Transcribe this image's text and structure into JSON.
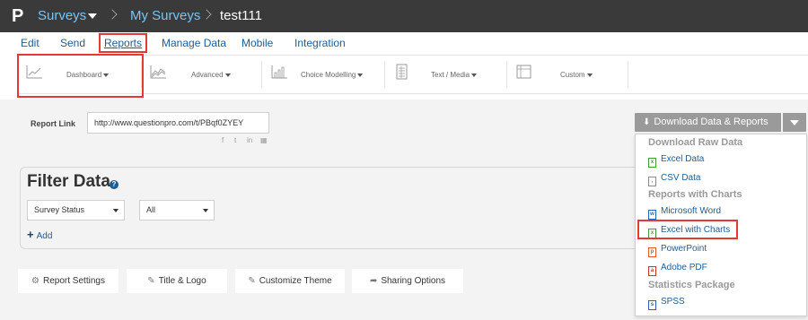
{
  "topbar": {
    "logo": "P",
    "surveys_label": "Surveys",
    "my_surveys_label": "My Surveys",
    "current_survey": "test111"
  },
  "main_nav": [
    "Edit",
    "Send",
    "Reports",
    "Manage Data",
    "Mobile",
    "Integration"
  ],
  "sub_nav": [
    "Dashboard",
    "Advanced",
    "Choice Modelling",
    "Text / Media",
    "Custom"
  ],
  "report_link": {
    "label": "Report Link",
    "value": "http://www.questionpro.com/t/PBqf0ZYEY"
  },
  "download_button": {
    "label": "Download Data & Reports"
  },
  "dropdown": {
    "raw_header": "Download Raw Data",
    "excel_data": "Excel Data",
    "csv_data": "CSV Data",
    "charts_header": "Reports with Charts",
    "word": "Microsoft Word",
    "excel_charts": "Excel with Charts",
    "powerpoint": "PowerPoint",
    "pdf": "Adobe PDF",
    "stats_header": "Statistics Package",
    "spss": "SPSS"
  },
  "filter": {
    "title": "Filter Data",
    "status_select": "Survey Status",
    "all_select": "All",
    "add_label": "Add"
  },
  "bottom_tabs": [
    "Report Settings",
    "Title & Logo",
    "Customize Theme",
    "Sharing Options"
  ],
  "colors": {
    "topbar": "#3a3a3a",
    "link": "#1e5c94",
    "highlight": "#e53935",
    "button_gray": "#9a9a9a"
  }
}
